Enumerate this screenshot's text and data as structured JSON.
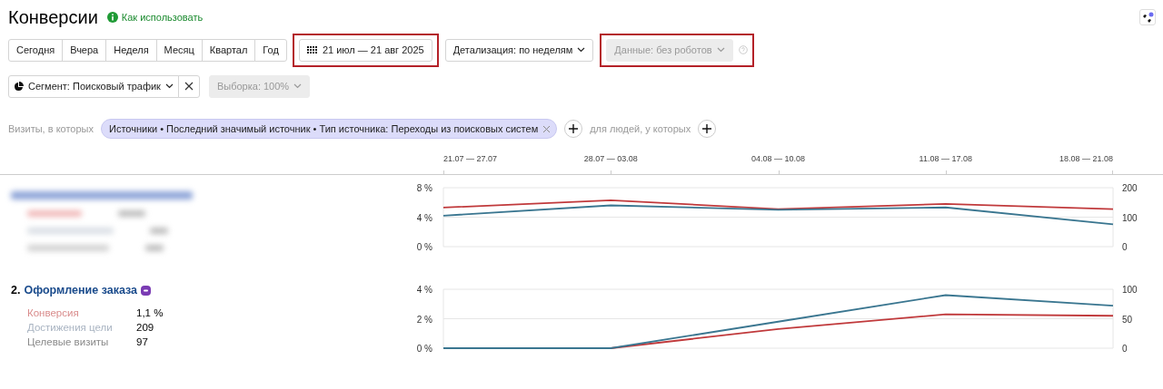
{
  "title": "Конверсии",
  "help_link": "Как использовать",
  "periods": [
    {
      "label": "Сегодня"
    },
    {
      "label": "Вчера"
    },
    {
      "label": "Неделя"
    },
    {
      "label": "Месяц"
    },
    {
      "label": "Квартал"
    },
    {
      "label": "Год"
    }
  ],
  "date_range": {
    "label": "21 июл — 21 авг 2025",
    "highlighted": true
  },
  "detail": {
    "label": "Детализация: по неделям"
  },
  "data_filter": {
    "label": "Данные: без роботов",
    "disabled": true,
    "highlighted": true
  },
  "segment": {
    "label": "Сегмент: Поисковый трафик"
  },
  "sampling": {
    "label": "Выборка: 100%",
    "disabled": true
  },
  "filter": {
    "prefix": "Визиты, в которых",
    "chip": "Источники • Последний значимый источник • Тип источника: Переходы из поисковых систем",
    "people": "для людей, у которых"
  },
  "weeks": [
    "21.07 — 27.07",
    "28.07 — 03.08",
    "04.08 — 10.08",
    "11.08 — 17.08",
    "18.08 — 21.08"
  ],
  "goals": [
    {
      "blurred": true,
      "chart_data": {
        "type": "line",
        "ylim": [
          0,
          8
        ],
        "yticks": [
          {
            "value": 0,
            "label": "0 %"
          },
          {
            "value": 4,
            "label": "4 %"
          },
          {
            "value": 8,
            "label": "8 %"
          }
        ],
        "y2lim": [
          0,
          200
        ],
        "y2ticks": [
          {
            "value": 0,
            "label": "0"
          },
          {
            "value": 100,
            "label": "100"
          },
          {
            "value": 200,
            "label": "200"
          }
        ],
        "series": [
          {
            "color": "#c0393b",
            "values": [
              5.3,
              6.3,
              5.1,
              5.8,
              5.1
            ]
          },
          {
            "color": "#3a7690",
            "axis": "y2",
            "values": [
              105,
              140,
              125,
              133,
              76
            ]
          }
        ]
      }
    },
    {
      "blurred": false,
      "number": "2.",
      "name": "Оформление заказа",
      "metrics": [
        {
          "label": "Конверсия",
          "value": "1,1 %",
          "color": "#d98c8c"
        },
        {
          "label": "Достижения цели",
          "value": "209",
          "color": "#a9b4c2"
        },
        {
          "label": "Целевые визиты",
          "value": "97",
          "color": "#8a8a8a"
        }
      ],
      "chart_data": {
        "type": "line",
        "ylim": [
          0,
          4
        ],
        "yticks": [
          {
            "value": 0,
            "label": "0 %"
          },
          {
            "value": 2,
            "label": "2 %"
          },
          {
            "value": 4,
            "label": "4 %"
          }
        ],
        "y2lim": [
          0,
          100
        ],
        "y2ticks": [
          {
            "value": 0,
            "label": "0"
          },
          {
            "value": 50,
            "label": "50"
          },
          {
            "value": 100,
            "label": "100"
          }
        ],
        "series": [
          {
            "color": "#c0393b",
            "values": [
              0,
              0,
              1.3,
              2.3,
              2.2
            ]
          },
          {
            "color": "#3a7690",
            "axis": "y2",
            "values": [
              0,
              0,
              45,
              90,
              72
            ]
          }
        ]
      }
    }
  ]
}
